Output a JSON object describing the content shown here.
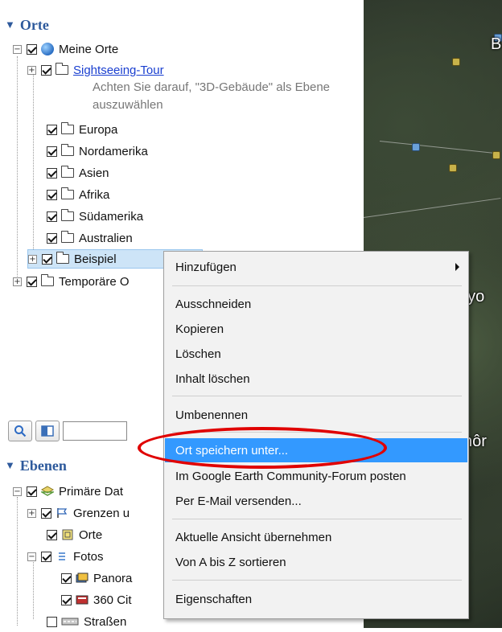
{
  "map": {
    "labels": [
      "B",
      "_yo",
      "hôr"
    ]
  },
  "places": {
    "header": "Orte",
    "root_label": "Meine Orte",
    "tour_label": "Sightseeing-Tour",
    "tour_desc_1": "Achten Sie darauf, \"3D-Gebäude\" als Ebene",
    "tour_desc_2": "auszuwählen",
    "folders": [
      "Europa",
      "Nordamerika",
      "Asien",
      "Afrika",
      "Südamerika",
      "Australien",
      "Beispiel"
    ],
    "temp_label": "Temporäre O"
  },
  "layers": {
    "header": "Ebenen",
    "primary": "Primäre Dat",
    "items": [
      "Grenzen u",
      "Orte",
      "Fotos",
      "Panora",
      "360 Cit",
      "Straßen"
    ]
  },
  "context_menu": {
    "items": [
      "Hinzufügen",
      "Ausschneiden",
      "Kopieren",
      "Löschen",
      "Inhalt löschen",
      "Umbenennen",
      "Ort speichern unter...",
      "Im Google Earth Community-Forum posten",
      "Per E-Mail versenden...",
      "Aktuelle Ansicht übernehmen",
      "Von A bis Z sortieren",
      "Eigenschaften"
    ],
    "highlight_color": "#3399ff",
    "annotation_color": "#e00000"
  }
}
